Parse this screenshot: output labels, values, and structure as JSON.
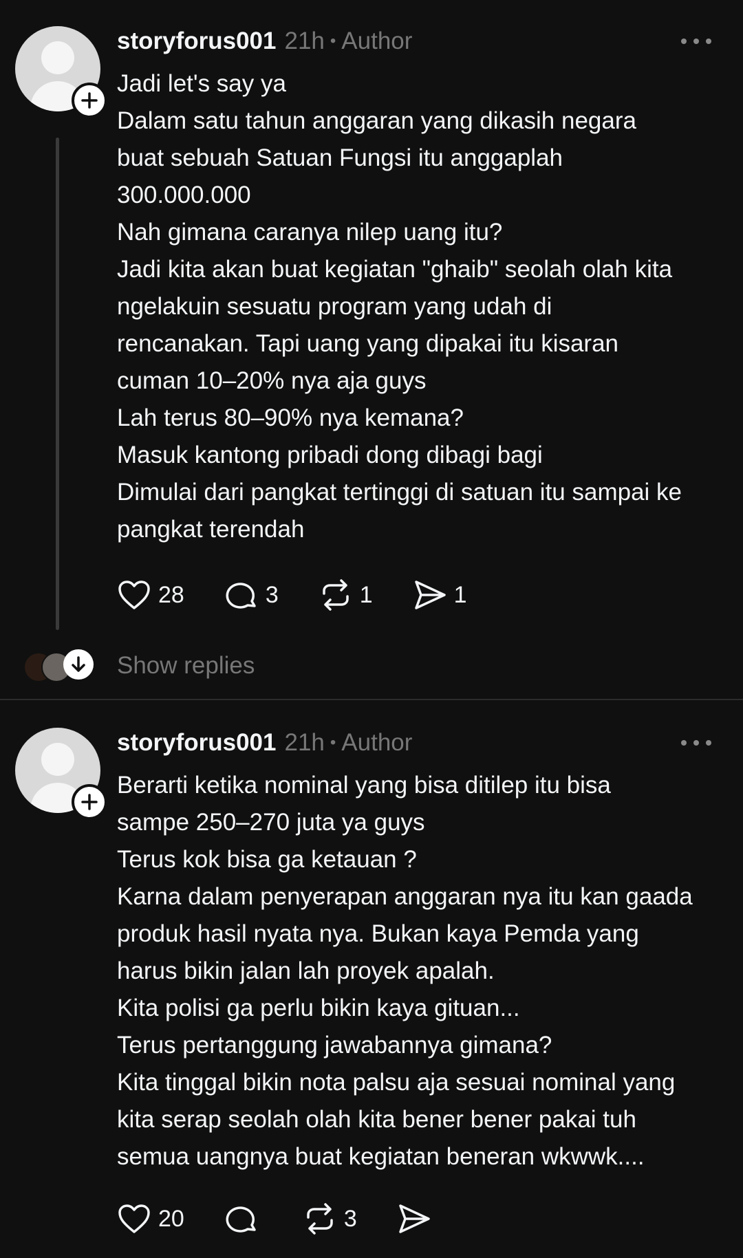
{
  "posts": [
    {
      "username": "storyforus001",
      "time": "21h",
      "separator": "•",
      "badge": "Author",
      "lines": [
        "Jadi let's say ya",
        "Dalam satu tahun anggaran yang dikasih negara",
        "buat sebuah Satuan Fungsi itu anggaplah",
        "300.000.000",
        "Nah gimana caranya nilep uang itu?",
        "Jadi kita akan buat kegiatan \"ghaib\" seolah olah kita",
        "ngelakuin sesuatu program yang udah di",
        "rencanakan. Tapi uang yang dipakai itu kisaran",
        "cuman 10–20% nya aja guys",
        "Lah terus 80–90% nya kemana?",
        "Masuk kantong pribadi dong dibagi bagi",
        "Dimulai dari pangkat tertinggi di satuan itu sampai ke",
        "pangkat terendah"
      ],
      "likes": "28",
      "replies": "3",
      "reposts": "1",
      "shares": "1"
    },
    {
      "username": "storyforus001",
      "time": "21h",
      "separator": "•",
      "badge": "Author",
      "lines": [
        "Berarti ketika nominal yang bisa ditilep itu bisa",
        "sampe 250–270 juta ya guys",
        "Terus kok bisa ga ketauan ?",
        "Karna dalam penyerapan anggaran nya itu kan gaada",
        "produk hasil nyata nya. Bukan kaya Pemda yang",
        "harus bikin jalan lah proyek apalah.",
        "Kita polisi ga perlu bikin kaya gituan...",
        "Terus pertanggung jawabannya gimana?",
        "Kita tinggal bikin nota palsu aja sesuai nominal yang",
        "kita serap seolah olah kita bener bener pakai tuh",
        "semua uangnya buat kegiatan beneran wkwwk...."
      ],
      "likes": "20",
      "reposts": "3"
    }
  ],
  "show_replies_label": "Show replies",
  "icons": {
    "like": "heart-icon",
    "reply": "comment-bubble-icon",
    "repost": "repost-icon",
    "share": "send-icon",
    "follow": "plus-icon",
    "more": "more-dots-icon",
    "expand": "arrow-down-icon"
  },
  "colors": {
    "background": "#101010",
    "text": "#f3f5f7",
    "muted": "#777777"
  }
}
